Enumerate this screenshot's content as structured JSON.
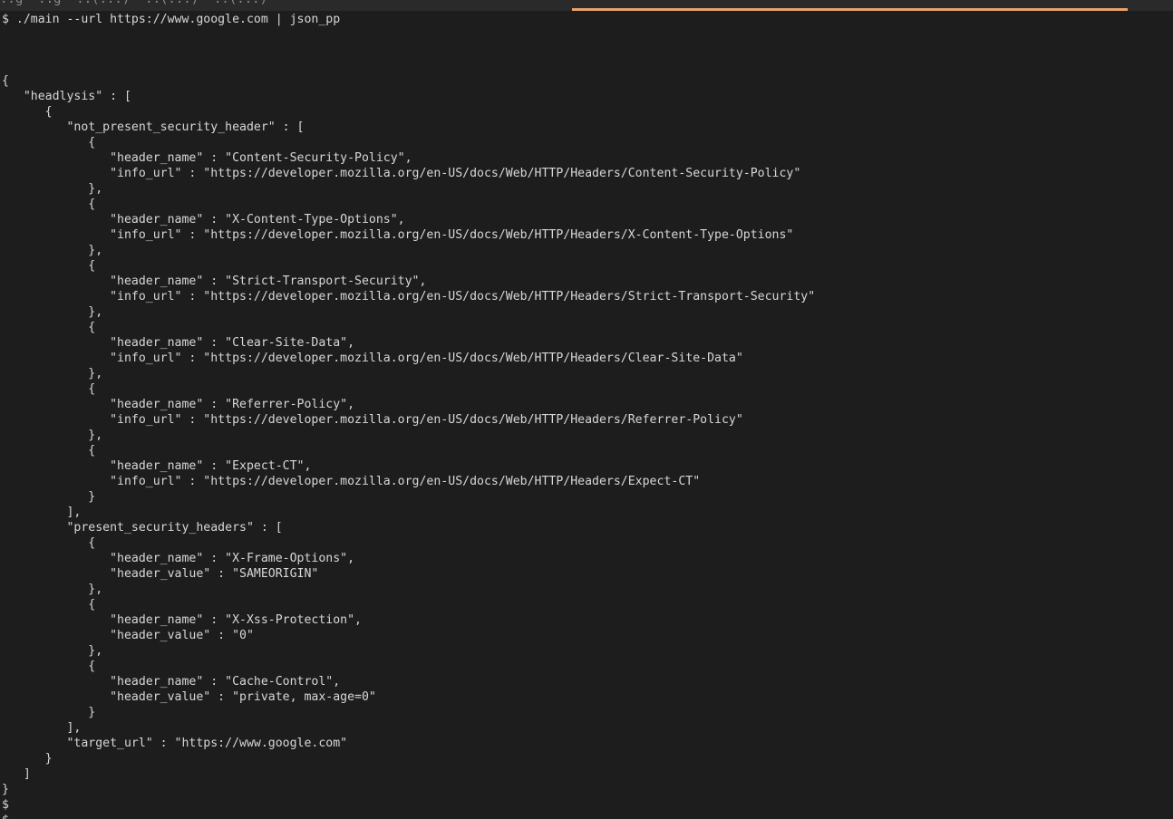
{
  "tab_bar": {
    "tab_text": "..g  ..g  ..(...)  ..(...)  ..(...)"
  },
  "terminal": {
    "lines": [
      "$ ./main --url https://www.google.com | json_pp",
      "",
      "",
      "",
      "{",
      "   \"headlysis\" : [",
      "      {",
      "         \"not_present_security_header\" : [",
      "            {",
      "               \"header_name\" : \"Content-Security-Policy\",",
      "               \"info_url\" : \"https://developer.mozilla.org/en-US/docs/Web/HTTP/Headers/Content-Security-Policy\"",
      "            },",
      "            {",
      "               \"header_name\" : \"X-Content-Type-Options\",",
      "               \"info_url\" : \"https://developer.mozilla.org/en-US/docs/Web/HTTP/Headers/X-Content-Type-Options\"",
      "            },",
      "            {",
      "               \"header_name\" : \"Strict-Transport-Security\",",
      "               \"info_url\" : \"https://developer.mozilla.org/en-US/docs/Web/HTTP/Headers/Strict-Transport-Security\"",
      "            },",
      "            {",
      "               \"header_name\" : \"Clear-Site-Data\",",
      "               \"info_url\" : \"https://developer.mozilla.org/en-US/docs/Web/HTTP/Headers/Clear-Site-Data\"",
      "            },",
      "            {",
      "               \"header_name\" : \"Referrer-Policy\",",
      "               \"info_url\" : \"https://developer.mozilla.org/en-US/docs/Web/HTTP/Headers/Referrer-Policy\"",
      "            },",
      "            {",
      "               \"header_name\" : \"Expect-CT\",",
      "               \"info_url\" : \"https://developer.mozilla.org/en-US/docs/Web/HTTP/Headers/Expect-CT\"",
      "            }",
      "         ],",
      "         \"present_security_headers\" : [",
      "            {",
      "               \"header_name\" : \"X-Frame-Options\",",
      "               \"header_value\" : \"SAMEORIGIN\"",
      "            },",
      "            {",
      "               \"header_name\" : \"X-Xss-Protection\",",
      "               \"header_value\" : \"0\"",
      "            },",
      "            {",
      "               \"header_name\" : \"Cache-Control\",",
      "               \"header_value\" : \"private, max-age=0\"",
      "            }",
      "         ],",
      "         \"target_url\" : \"https://www.google.com\"",
      "      }",
      "   ]",
      "}",
      "$",
      "$"
    ]
  },
  "colors": {
    "background": "#1d1d1d",
    "text": "#d7d7d7",
    "tab_bar": "#2a2a2a",
    "active_tab_accent": "#e8a36b"
  }
}
